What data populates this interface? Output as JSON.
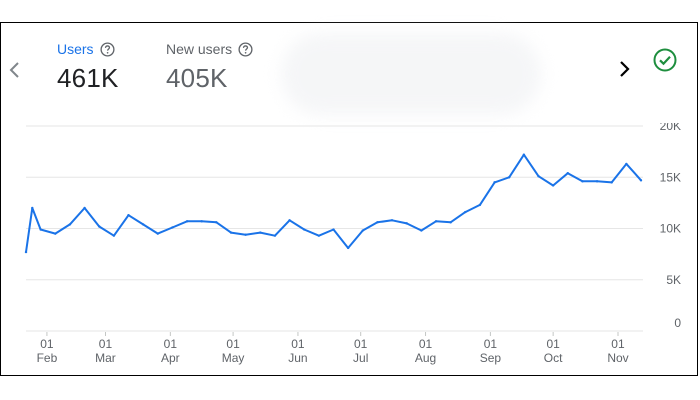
{
  "metrics": {
    "users": {
      "label": "Users",
      "value": "461K"
    },
    "new_users": {
      "label": "New users",
      "value": "405K"
    }
  },
  "icons": {
    "prev": "chevron-left-icon",
    "next": "chevron-right-icon",
    "help": "help-circle-icon",
    "status": "check-circle-icon"
  },
  "colors": {
    "accent": "#1a73e8",
    "line": "#1a73e8",
    "status": "#1e8e3e"
  },
  "chart_data": {
    "type": "line",
    "title": "",
    "xlabel": "",
    "ylabel": "",
    "ylim": [
      0,
      20000
    ],
    "y_ticks": [
      "20K",
      "15K",
      "10K",
      "5K",
      "0"
    ],
    "y_tick_values": [
      20000,
      15000,
      10000,
      5000,
      0
    ],
    "x_ticks": [
      {
        "day": "01",
        "month": "Feb"
      },
      {
        "day": "01",
        "month": "Mar"
      },
      {
        "day": "01",
        "month": "Apr"
      },
      {
        "day": "01",
        "month": "May"
      },
      {
        "day": "01",
        "month": "Jun"
      },
      {
        "day": "01",
        "month": "Jul"
      },
      {
        "day": "01",
        "month": "Aug"
      },
      {
        "day": "01",
        "month": "Sep"
      },
      {
        "day": "01",
        "month": "Oct"
      },
      {
        "day": "01",
        "month": "Nov"
      }
    ],
    "x": [
      "2023-01-22",
      "2023-01-25",
      "2023-01-29",
      "2023-02-05",
      "2023-02-12",
      "2023-02-19",
      "2023-02-26",
      "2023-03-05",
      "2023-03-12",
      "2023-03-19",
      "2023-03-26",
      "2023-04-02",
      "2023-04-09",
      "2023-04-16",
      "2023-04-23",
      "2023-04-30",
      "2023-05-07",
      "2023-05-14",
      "2023-05-21",
      "2023-05-28",
      "2023-06-04",
      "2023-06-11",
      "2023-06-18",
      "2023-06-25",
      "2023-07-02",
      "2023-07-09",
      "2023-07-16",
      "2023-07-23",
      "2023-07-30",
      "2023-08-06",
      "2023-08-13",
      "2023-08-20",
      "2023-08-27",
      "2023-09-03",
      "2023-09-10",
      "2023-09-17",
      "2023-09-24",
      "2023-10-01",
      "2023-10-08",
      "2023-10-15",
      "2023-10-22",
      "2023-10-29",
      "2023-11-05",
      "2023-11-12"
    ],
    "series": [
      {
        "values": [
          7700,
          12000,
          9900,
          9500,
          10400,
          12000,
          10200,
          9300,
          11300,
          10400,
          9500,
          10100,
          10700,
          10700,
          10600,
          9600,
          9400,
          9600,
          9300,
          10800,
          9900,
          9300,
          9900,
          8100,
          9800,
          10600,
          10800,
          10500,
          9800,
          10700,
          10600,
          11600,
          12300,
          14500,
          15000,
          17200,
          15100,
          14200,
          15400,
          14600,
          14600,
          14500,
          16300,
          14700
        ]
      }
    ],
    "grid": true,
    "legend": "none"
  }
}
